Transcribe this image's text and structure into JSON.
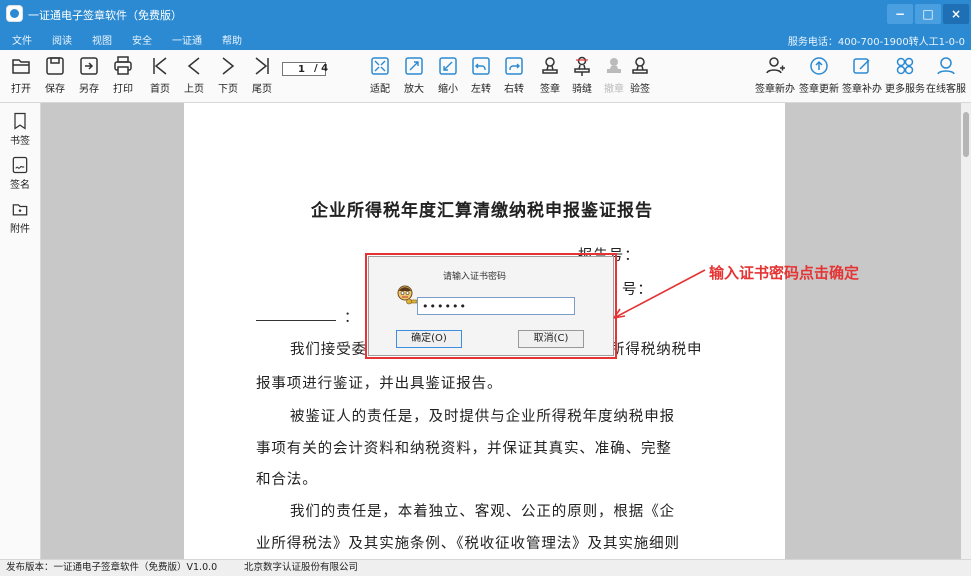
{
  "window": {
    "title": "一证通电子签章软件（免费版）",
    "controls": [
      "−",
      "□",
      "×"
    ]
  },
  "menu": {
    "items": [
      "文件",
      "阅读",
      "视图",
      "安全",
      "一证通",
      "帮助"
    ],
    "service": "服务电话：400-700-1900转人工1-0-0"
  },
  "toolbar": {
    "left": [
      {
        "label": "打开",
        "icon": "folder-open-icon"
      },
      {
        "label": "保存",
        "icon": "save-icon"
      },
      {
        "label": "另存",
        "icon": "save-as-icon"
      },
      {
        "label": "打印",
        "icon": "print-icon"
      },
      {
        "label": "首页",
        "icon": "first-page-icon"
      },
      {
        "label": "上页",
        "icon": "prev-page-icon"
      },
      {
        "label": "下页",
        "icon": "next-page-icon"
      },
      {
        "label": "尾页",
        "icon": "last-page-icon"
      }
    ],
    "page_current": "1",
    "page_total": "/ 4",
    "middle": [
      {
        "label": "适配",
        "icon": "fit-icon"
      },
      {
        "label": "放大",
        "icon": "zoom-in-icon"
      },
      {
        "label": "缩小",
        "icon": "zoom-out-icon"
      },
      {
        "label": "左转",
        "icon": "rotate-left-icon"
      },
      {
        "label": "右转",
        "icon": "rotate-right-icon"
      },
      {
        "label": "签章",
        "icon": "stamp-icon"
      },
      {
        "label": "骑缝",
        "icon": "seam-stamp-icon"
      },
      {
        "label": "撤章",
        "icon": "revoke-stamp-icon"
      },
      {
        "label": "验签",
        "icon": "verify-icon"
      }
    ],
    "right": [
      {
        "label": "签章新办",
        "icon": "new-seal-icon"
      },
      {
        "label": "签章更新",
        "icon": "update-seal-icon"
      },
      {
        "label": "签章补办",
        "icon": "reissue-seal-icon"
      },
      {
        "label": "更多服务",
        "icon": "more-services-icon"
      },
      {
        "label": "在线客服",
        "icon": "online-support-icon"
      }
    ]
  },
  "left_panel": [
    {
      "label": "书签",
      "icon": "bookmark-icon"
    },
    {
      "label": "签名",
      "icon": "signature-icon"
    },
    {
      "label": "附件",
      "icon": "attachment-icon"
    }
  ],
  "document": {
    "title": "企业所得税年度汇算清缴纳税申报鉴证报告",
    "report_no_label": "报告号：",
    "second_label": "号：",
    "colon": "：",
    "para1_start": "我们接受委",
    "para1_end": "所得税纳税申",
    "line2": "报事项进行鉴证，并出具鉴证报告。",
    "line3": "被鉴证人的责任是，及时提供与企业所得税年度纳税申报",
    "line4": "事项有关的会计资料和纳税资料，并保证其真实、准确、完整",
    "line5": "和合法。",
    "line6": "我们的责任是，本着独立、客观、公正的原则，根据《企",
    "line7": "业所得税法》及其实施条例、《税收征收管理法》及其实施细则"
  },
  "dialog": {
    "title": "请输入证书密码",
    "password_value": "••••••",
    "ok_label": "确定(O)",
    "cancel_label": "取消(C)"
  },
  "annotation": {
    "text": "输入证书密码点击确定",
    "color": "#e53434"
  },
  "status": {
    "version": "发布版本：一证通电子签章软件（免费版）V1.0.0",
    "company": "北京数字认证股份有限公司"
  },
  "colors": {
    "titlebar": "#2b8ad1",
    "highlight": "#e53434"
  }
}
